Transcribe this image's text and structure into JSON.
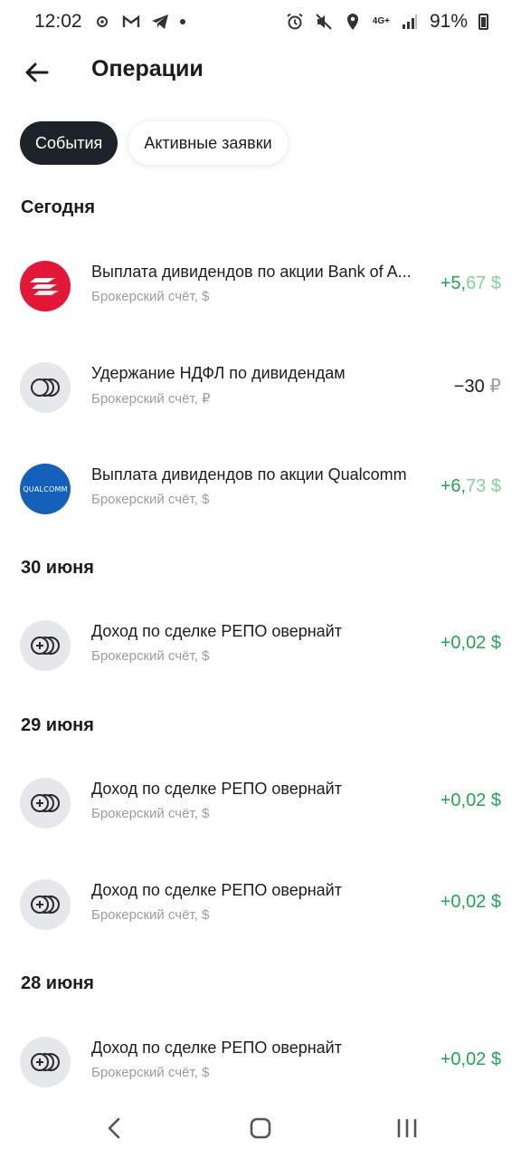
{
  "status_bar": {
    "time": "12:02",
    "battery": "91%",
    "network": "4G+"
  },
  "header": {
    "title": "Операции"
  },
  "tabs": [
    {
      "label": "События",
      "active": true
    },
    {
      "label": "Активные заявки",
      "active": false
    }
  ],
  "sections": [
    {
      "title": "Сегодня",
      "items": [
        {
          "title": "Выплата дивидендов по акции Bank of A...",
          "subtitle": "Брокерский счёт, $",
          "amount_int": "+5,",
          "amount_dec": "67",
          "currency": " $",
          "icon": "bank-of-america-logo"
        },
        {
          "title": "Удержание НДФЛ по дивидендам",
          "subtitle": "Брокерский счёт, ₽",
          "amount_int": "−30",
          "amount_dec": "",
          "currency": " ₽",
          "icon": "coins-icon"
        },
        {
          "title": "Выплата дивидендов по акции Qualcomm",
          "subtitle": "Брокерский счёт, $",
          "amount_int": "+6,",
          "amount_dec": "73",
          "currency": " $",
          "icon": "qualcomm-logo",
          "logo_text": "QUALCOMM"
        }
      ]
    },
    {
      "title": "30 июня",
      "items": [
        {
          "title": "Доход по сделке РЕПО овернайт",
          "subtitle": "Брокерский счёт, $",
          "amount_int": "+0,02",
          "amount_dec": "",
          "currency": " $",
          "icon": "coins-plus-icon"
        }
      ]
    },
    {
      "title": "29 июня",
      "items": [
        {
          "title": "Доход по сделке РЕПО овернайт",
          "subtitle": "Брокерский счёт, $",
          "amount_int": "+0,02",
          "amount_dec": "",
          "currency": " $",
          "icon": "coins-plus-icon"
        },
        {
          "title": "Доход по сделке РЕПО овернайт",
          "subtitle": "Брокерский счёт, $",
          "amount_int": "+0,02",
          "amount_dec": "",
          "currency": " $",
          "icon": "coins-plus-icon"
        }
      ]
    },
    {
      "title": "28 июня",
      "items": [
        {
          "title": "Доход по сделке РЕПО овернайт",
          "subtitle": "Брокерский счёт, $",
          "amount_int": "+0,02",
          "amount_dec": "",
          "currency": " $",
          "icon": "coins-plus-icon"
        }
      ]
    }
  ],
  "colors": {
    "positive": "#1fa84f",
    "active_tab": "#1e2329",
    "boa_red": "#e31837",
    "qualcomm_blue": "#1560b8"
  }
}
